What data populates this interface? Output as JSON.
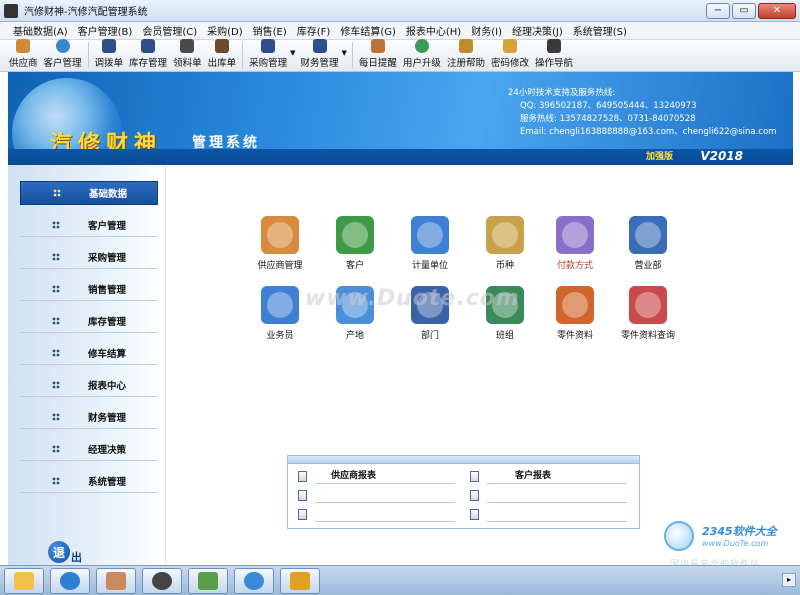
{
  "window": {
    "title": "汽修财神-汽修汽配管理系统",
    "minimize": "−",
    "maximize": "▭",
    "close": "✕"
  },
  "menu": [
    "基础数据(A)",
    "客户管理(B)",
    "会员管理(C)",
    "采购(D)",
    "销售(E)",
    "库存(F)",
    "修车结算(G)",
    "报表中心(H)",
    "财务(I)",
    "经理决策(J)",
    "系统管理(S)"
  ],
  "toolbar": {
    "supplier": "供应商",
    "customer_mgmt": "客户管理",
    "transfer": "调拨单",
    "stock_mgmt": "库存管理",
    "material_req": "领料单",
    "out_stock": "出库单",
    "purchase_mgmt": "采购管理",
    "finance_mgmt": "财务管理",
    "daily_reminder": "每日提醒",
    "user_upgrade": "用户升级",
    "register_help": "注册帮助",
    "change_password": "密码修改",
    "guide": "操作导航"
  },
  "banner": {
    "brand": "汽修财神",
    "subbrand": "管理系统",
    "contact_title": "24小时技术支持及服务热线:",
    "qq": "QQ:  396502187、649505444、13240973",
    "hotline": "服务热线:  13574827528、0731-84070528",
    "email": "Email:  chengli163888888@163.com、chengli622@sina.com",
    "edition": "加强版",
    "version": "V2018"
  },
  "sidebar": {
    "items": [
      {
        "label": "基础数据",
        "active": true
      },
      {
        "label": "客户管理",
        "active": false
      },
      {
        "label": "采购管理",
        "active": false
      },
      {
        "label": "销售管理",
        "active": false
      },
      {
        "label": "库存管理",
        "active": false
      },
      {
        "label": "修车结算",
        "active": false
      },
      {
        "label": "报表中心",
        "active": false
      },
      {
        "label": "财务管理",
        "active": false
      },
      {
        "label": "经理决策",
        "active": false
      },
      {
        "label": "系统管理",
        "active": false
      }
    ],
    "exit_char1": "退",
    "exit_char2": "出"
  },
  "modules": [
    {
      "label": "供应商管理",
      "color": "#d98a3c"
    },
    {
      "label": "客户",
      "color": "#3f9a46"
    },
    {
      "label": "计量单位",
      "color": "#3f7fd4"
    },
    {
      "label": "币种",
      "color": "#c7a24a"
    },
    {
      "label": "付款方式",
      "color": "#8a6fc9"
    },
    {
      "label": "营业部",
      "color": "#3a6fb8"
    },
    {
      "label": "业务员",
      "color": "#3f7fd4"
    },
    {
      "label": "产地",
      "color": "#4a8fd8"
    },
    {
      "label": "部门",
      "color": "#3a62a8"
    },
    {
      "label": "班组",
      "color": "#3b8a5a"
    },
    {
      "label": "零件资料",
      "color": "#d0662c"
    },
    {
      "label": "零件资料查询",
      "color": "#c84a4a"
    }
  ],
  "watermark": "www.Duote.com",
  "reports": {
    "supplier_report": "供应商报表",
    "customer_report": "客户报表"
  },
  "corner": {
    "brand": "2345软件大全",
    "url": "www.DuoTe.com",
    "slogan": "国内最安全的软件站"
  },
  "taskbar": [
    {
      "name": "folder-task",
      "color": "#f2c14a"
    },
    {
      "name": "browser-task",
      "color": "#2d7fd6"
    },
    {
      "name": "photo-task",
      "color": "#c98a5e"
    },
    {
      "name": "eye-task",
      "color": "#444444"
    },
    {
      "name": "money-task",
      "color": "#5a9e4a"
    },
    {
      "name": "chat-task",
      "color": "#3a8ad8"
    },
    {
      "name": "car-task",
      "color": "#e0a020"
    }
  ]
}
